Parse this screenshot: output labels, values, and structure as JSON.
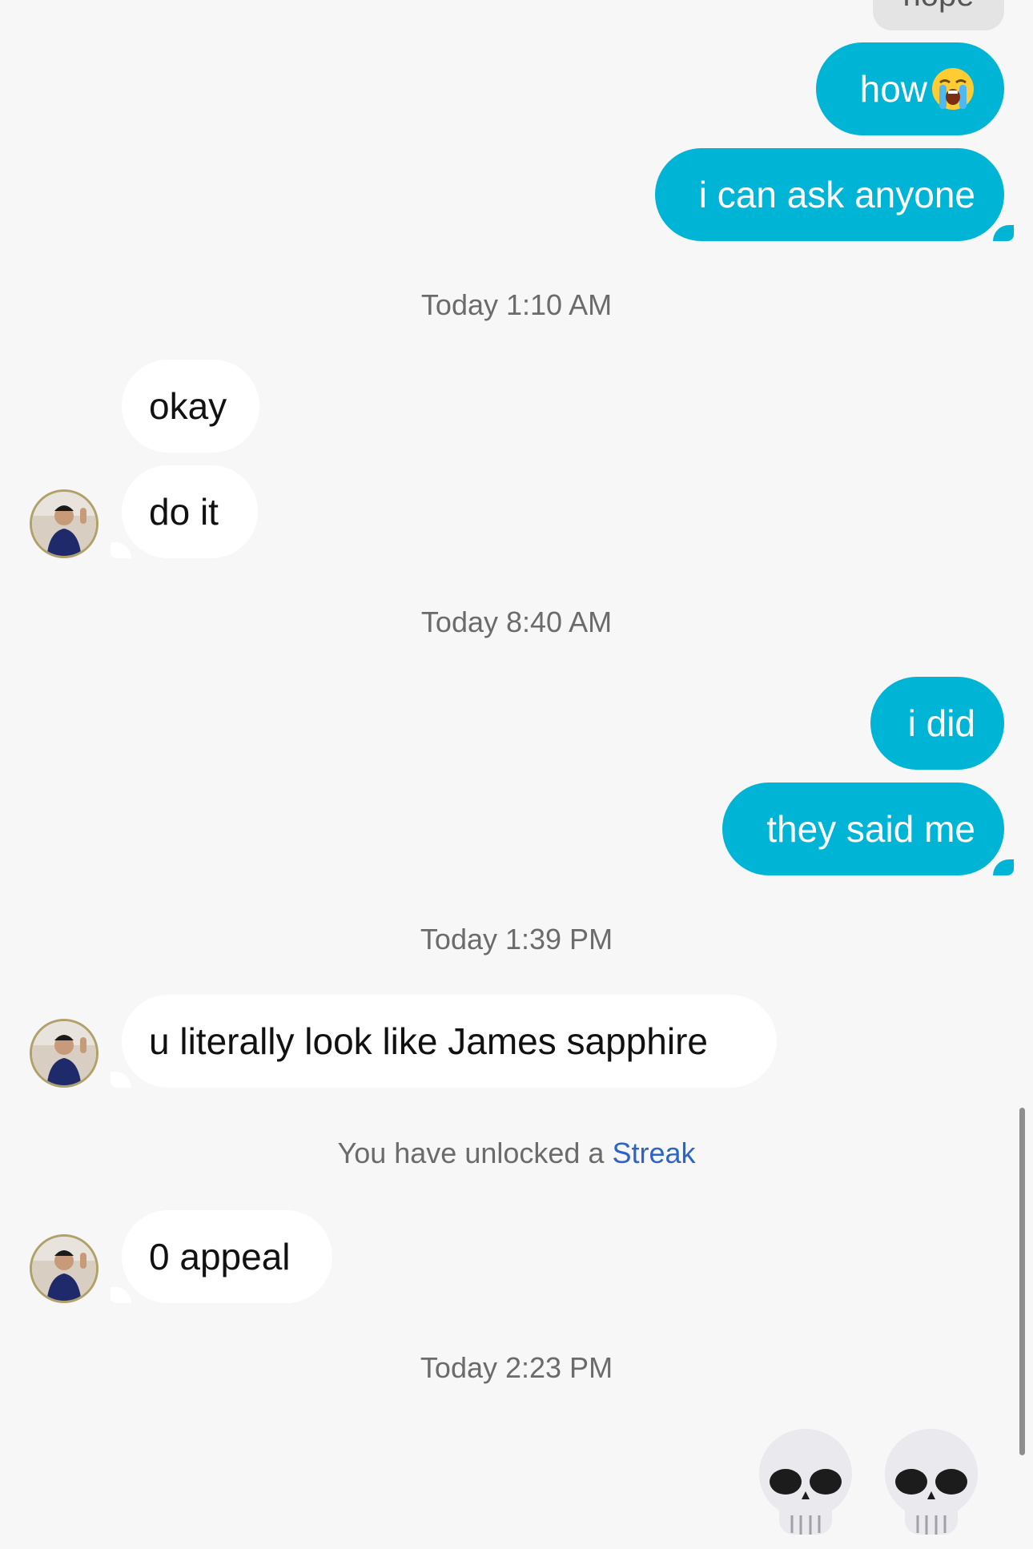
{
  "messages": {
    "peek": "nope",
    "how": "how",
    "ask": "i can ask anyone",
    "okay": "okay",
    "doit": "do it",
    "idid": "i did",
    "said": "they said me",
    "james": "u literally look like James sapphire",
    "appeal": "0 appeal"
  },
  "timestamps": {
    "t1": "Today 1:10 AM",
    "t2": "Today 8:40 AM",
    "t3": "Today 1:39 PM",
    "t4": "Today 2:23 PM"
  },
  "system": {
    "prefix": "You have unlocked a ",
    "link": "Streak"
  },
  "icons": [
    "loudly-crying-face-emoji",
    "skull-emoji",
    "skull-emoji",
    "contact-avatar"
  ],
  "colors": {
    "outgoing_bubble": "#00b4d6",
    "incoming_bubble": "#ffffff",
    "background": "#f7f7f7",
    "link": "#2c64c7"
  }
}
